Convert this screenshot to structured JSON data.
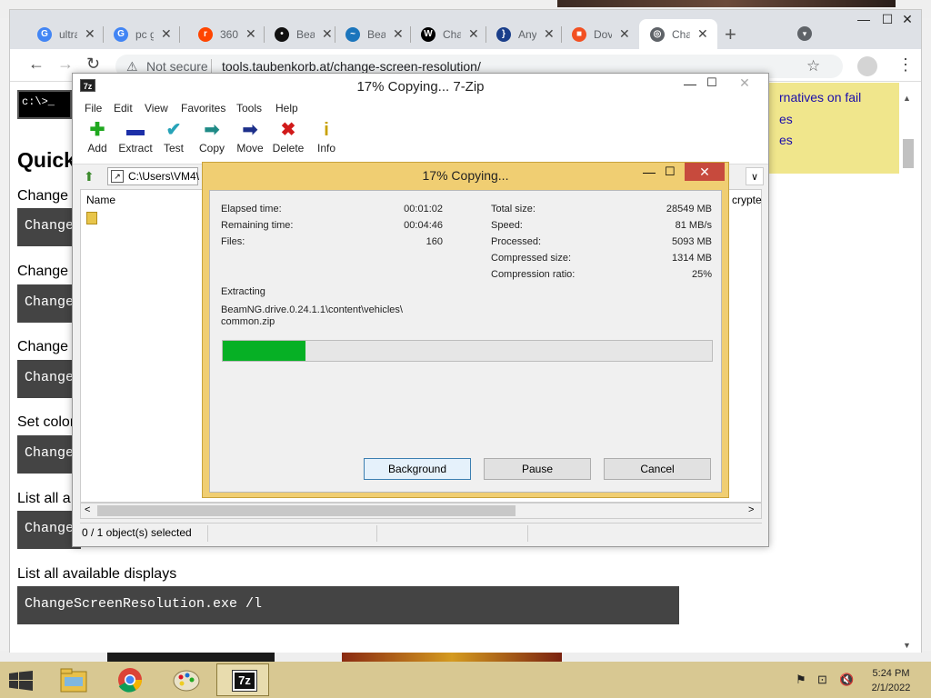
{
  "browser": {
    "tabs": [
      {
        "icon": "google-icon",
        "label": "ultra",
        "letter": "G",
        "color": "#4285f4"
      },
      {
        "icon": "google-icon",
        "label": "pc g",
        "letter": "G",
        "color": "#4285f4"
      },
      {
        "icon": "reddit-icon",
        "label": "360",
        "letter": "r",
        "color": "#ff4500"
      },
      {
        "icon": "beamng-icon",
        "label": "Bea",
        "letter": "•",
        "color": "#111111"
      },
      {
        "icon": "steam-icon",
        "label": "Bea",
        "letter": "~",
        "color": "#1b75bc"
      },
      {
        "icon": "wikipedia-icon",
        "label": "Cha",
        "letter": "W",
        "color": "#000000"
      },
      {
        "icon": "bracket-icon",
        "label": "Any",
        "letter": "}",
        "color": "#1a3e8a"
      },
      {
        "icon": "microsoft-icon",
        "label": "Dov",
        "letter": "■",
        "color": "#f25022"
      },
      {
        "icon": "globe-icon",
        "label": "Cha",
        "letter": "◎",
        "color": "#5f6368"
      }
    ],
    "new_tab": "+",
    "security": "Not secure",
    "url": "tools.taubenkorb.at/change-screen-resolution/",
    "window_buttons": {
      "min": "—",
      "max": "☐",
      "close": "✕"
    }
  },
  "page": {
    "cmd_prompt": "c:\\>_",
    "heading": "Quick",
    "yellow_links": [
      "rnatives on fail",
      "es",
      "es"
    ],
    "rows": [
      {
        "label": "Change",
        "code": "Change"
      },
      {
        "label": "Change",
        "code": "Change"
      },
      {
        "label": "Change",
        "code": "Change"
      },
      {
        "label": "Set color",
        "code": "Change"
      },
      {
        "label": "List all a",
        "code": "Change"
      }
    ],
    "full_row": {
      "label": "List all available displays",
      "code": "ChangeScreenResolution.exe /l"
    }
  },
  "zip": {
    "title": "17% Copying... 7-Zip",
    "icon_text": "7z",
    "menu": [
      "File",
      "Edit",
      "View",
      "Favorites",
      "Tools",
      "Help"
    ],
    "toolbar": [
      {
        "label": "Add",
        "glyph": "✚",
        "color": "#1fa81f",
        "icon": "add-icon"
      },
      {
        "label": "Extract",
        "glyph": "▬",
        "color": "#1c2fa8",
        "icon": "extract-icon"
      },
      {
        "label": "Test",
        "glyph": "✔",
        "color": "#27a3b8",
        "icon": "test-icon"
      },
      {
        "label": "Copy",
        "glyph": "➡",
        "color": "#1e8a86",
        "icon": "copy-icon"
      },
      {
        "label": "Move",
        "glyph": "➡",
        "color": "#1c2f8a",
        "icon": "move-icon"
      },
      {
        "label": "Delete",
        "glyph": "✖",
        "color": "#d11a1a",
        "icon": "delete-icon"
      },
      {
        "label": "Info",
        "glyph": "i",
        "color": "#c8a100",
        "icon": "info-icon"
      }
    ],
    "path": "C:\\Users\\VM4\\",
    "columns": {
      "name": "Name",
      "crypted": "crypte"
    },
    "status": "0 / 1 object(s) selected"
  },
  "dialog": {
    "title": "17% Copying...",
    "left": [
      {
        "k": "Elapsed time:",
        "v": "00:01:02"
      },
      {
        "k": "Remaining time:",
        "v": "00:04:46"
      },
      {
        "k": "Files:",
        "v": "160"
      }
    ],
    "right": [
      {
        "k": "Total size:",
        "v": "28549 MB"
      },
      {
        "k": "Speed:",
        "v": "81 MB/s"
      },
      {
        "k": "Processed:",
        "v": "5093 MB"
      },
      {
        "k": "Compressed size:",
        "v": "1314 MB"
      },
      {
        "k": "Compression ratio:",
        "v": "25%"
      }
    ],
    "operation": "Extracting",
    "file_line1": "BeamNG.drive.0.24.1.1\\content\\vehicles\\",
    "file_line2": "common.zip",
    "progress": 0.17,
    "buttons": {
      "background": "Background",
      "pause": "Pause",
      "cancel": "Cancel"
    }
  },
  "taskbar": {
    "time": "5:24 PM",
    "date": "2/1/2022",
    "apps": [
      "file-explorer-icon",
      "chrome-icon",
      "paint-icon",
      "7zip-icon"
    ],
    "active_app_label": "7z"
  }
}
